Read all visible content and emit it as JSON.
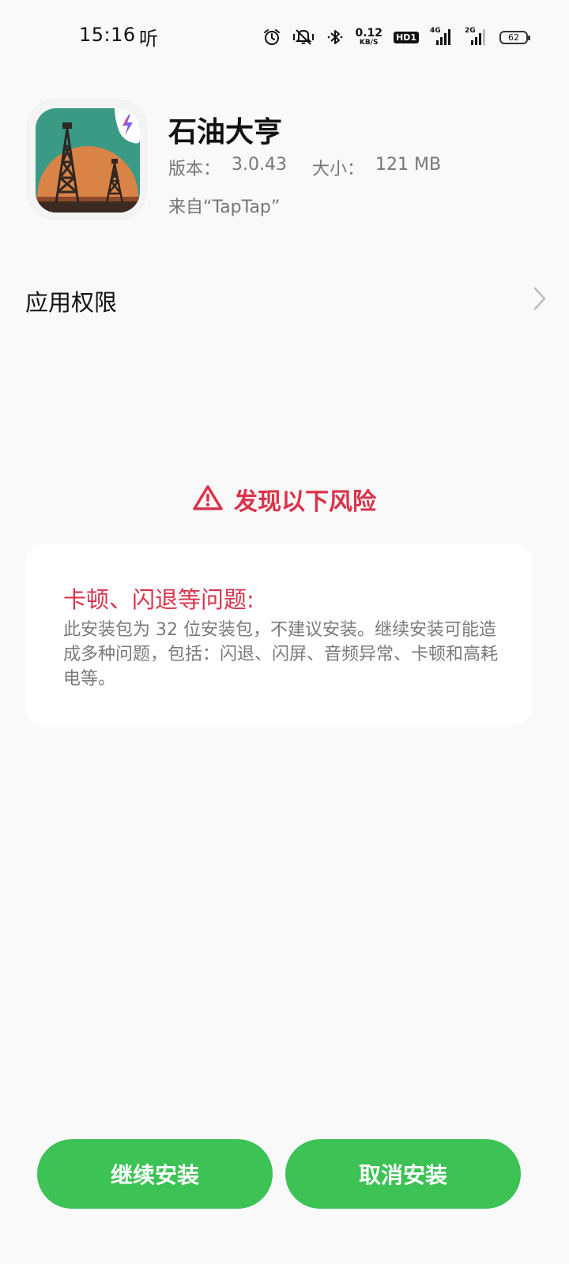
{
  "status_bar": {
    "time": "15:16",
    "listen_label": "听",
    "net_speed_value": "0.12",
    "net_speed_unit": "KB/S",
    "hd_badge": "HD1",
    "signal1_tag": "4G",
    "signal2_tag": "2G",
    "battery": "62"
  },
  "app": {
    "name": "石油大亨",
    "version_label": "版本：",
    "version": "3.0.43",
    "size_label": "大小：",
    "size": "121 MB",
    "source": "来自“TapTap”",
    "icon": "oil-derrick-icon"
  },
  "permissions": {
    "label": "应用权限"
  },
  "warning": {
    "title": "发现以下风险",
    "color": "#d9334a"
  },
  "risk": {
    "title": "卡顿、闪退等问题:",
    "description": "此安装包为 32 位安装包，不建议安装。继续安装可能造成多种问题，包括：闪退、闪屏、音频异常、卡顿和高耗电等。"
  },
  "buttons": {
    "continue_label": "继续安装",
    "cancel_label": "取消安装",
    "color": "#3cc255"
  }
}
